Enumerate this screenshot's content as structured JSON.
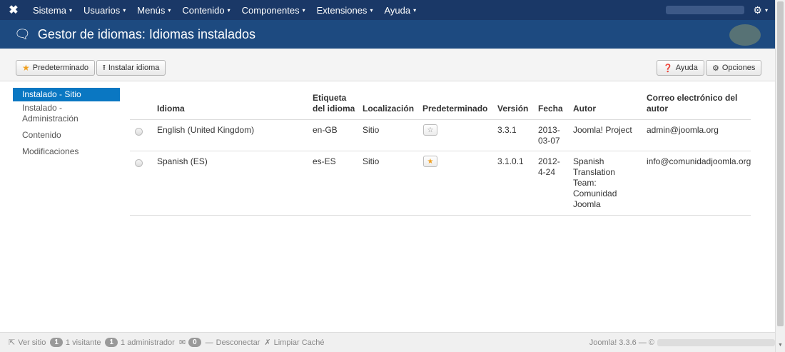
{
  "topnav": {
    "logo": "✖",
    "menu": [
      {
        "label": "Sistema"
      },
      {
        "label": "Usuarios"
      },
      {
        "label": "Menús"
      },
      {
        "label": "Contenido"
      },
      {
        "label": "Componentes"
      },
      {
        "label": "Extensiones"
      },
      {
        "label": "Ayuda"
      }
    ],
    "caret": "▾",
    "gear_icon": "gear-icon"
  },
  "header": {
    "title": "Gestor de idiomas: Idiomas instalados",
    "icon": "comments-icon"
  },
  "toolbar": {
    "default_label": "Predeterminado",
    "install_label": "Instalar idioma",
    "help_label": "Ayuda",
    "options_label": "Opciones"
  },
  "sidebar": {
    "items": [
      {
        "label": "Instalado - Sitio",
        "active": true
      },
      {
        "label": "Instalado - Administración",
        "active": false
      },
      {
        "label": "Contenido",
        "active": false
      },
      {
        "label": "Modificaciones",
        "active": false
      }
    ]
  },
  "table": {
    "headers": {
      "idioma": "Idioma",
      "etiqueta_1": "Etiqueta",
      "etiqueta_2": "del idioma",
      "localizacion": "Localización",
      "predeterminado": "Predeterminado",
      "version": "Versión",
      "fecha": "Fecha",
      "autor": "Autor",
      "correo_1": "Correo electrónico del",
      "correo_2": "autor"
    },
    "rows": [
      {
        "idioma": "English (United Kingdom)",
        "etiqueta": "en-GB",
        "localizacion": "Sitio",
        "default": false,
        "version": "3.3.1",
        "fecha_1": "2013-",
        "fecha_2": "03-07",
        "autor": "Joomla! Project",
        "correo": "admin@joomla.org"
      },
      {
        "idioma": "Spanish (ES)",
        "etiqueta": "es-ES",
        "localizacion": "Sitio",
        "default": true,
        "version": "3.1.0.1",
        "fecha_1": "2012-",
        "fecha_2": "4-24",
        "autor_lines": [
          "Spanish",
          "Translation",
          "Team:",
          "Comunidad",
          "Joomla"
        ],
        "correo": "info@comunidadjoomla.org"
      }
    ]
  },
  "footer": {
    "ver_sitio": "Ver sitio",
    "visitor_count": "1",
    "visitor_label": "1 visitante",
    "admin_count": "1",
    "admin_label": "1 administrador",
    "mail_count": "0",
    "logout": "Desconectar",
    "clear_cache": "Limpiar Caché",
    "version": "Joomla! 3.3.6 — ©"
  },
  "colors": {
    "topnav_bg": "#1a3867",
    "header_bg": "#1d4a80",
    "active_item": "#0a77c2",
    "star": "#f0a020"
  }
}
